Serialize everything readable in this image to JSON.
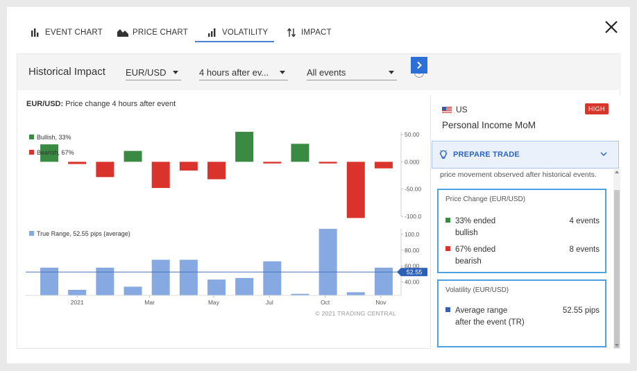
{
  "tabs": [
    {
      "label": "EVENT CHART",
      "icon": "bar-chart-icon"
    },
    {
      "label": "PRICE CHART",
      "icon": "area-chart-icon"
    },
    {
      "label": "VOLATILITY",
      "icon": "volatility-icon",
      "active": true
    },
    {
      "label": "IMPACT",
      "icon": "up-down-arrows-icon"
    }
  ],
  "filter": {
    "title": "Historical Impact",
    "pair": "EUR/USD",
    "horizon": "4 hours after ev...",
    "events": "All events"
  },
  "chart_data": {
    "type": "bar",
    "title_bold": "EUR/USD:",
    "title_rest": " Price change 4 hours after event",
    "copyright": "© 2021 TRADING CENTRAL",
    "x_tick_labels": [
      "2021",
      "Mar",
      "May",
      "Jul",
      "Oct",
      "Nov"
    ],
    "price_change": {
      "legend": [
        {
          "name": "Bullish, 33%",
          "color": "#3a8a43"
        },
        {
          "name": "Bearish, 67%",
          "color": "#d9332b"
        }
      ],
      "ylim": [
        -100,
        50
      ],
      "y_tick_labels": [
        "50.00",
        "0.000",
        "-50.00",
        "-100.0"
      ],
      "y_ticks": [
        50,
        0,
        -50,
        -100
      ],
      "values": [
        32,
        -4,
        -28,
        20,
        -48,
        -16,
        -32,
        55,
        -3,
        33,
        -3,
        -103,
        -12
      ]
    },
    "true_range": {
      "legend": "True Range, 52.55 pips (average)",
      "color": "#85a9e0",
      "ylim": [
        23,
        107
      ],
      "y_tick_labels": [
        "100.0",
        "80.00",
        "60.00",
        "40.00"
      ],
      "y_ticks": [
        100,
        80,
        60,
        40
      ],
      "average_label": "52.55",
      "average": 52.55,
      "values": [
        58,
        30,
        58,
        34,
        68,
        68,
        43,
        45,
        66,
        25,
        107,
        27,
        58
      ]
    }
  },
  "panel": {
    "country": "US",
    "impact": "HIGH",
    "event": "Personal Income MoM",
    "prepare_trade": "PREPARE TRADE",
    "description": "price movement observed after historical events.",
    "price_change": {
      "title": "Price Change (EUR/USD)",
      "rows": [
        {
          "text": "33% ended bullish",
          "value": "4 events",
          "color": "#3a8a43"
        },
        {
          "text": "67% ended bearish",
          "value": "8 events",
          "color": "#d9332b"
        }
      ]
    },
    "volatility": {
      "title": "Volatility (EUR/USD)",
      "rows": [
        {
          "text": "Average range after the event (TR)",
          "value": "52.55 pips",
          "color": "#3a5fae"
        }
      ]
    }
  }
}
